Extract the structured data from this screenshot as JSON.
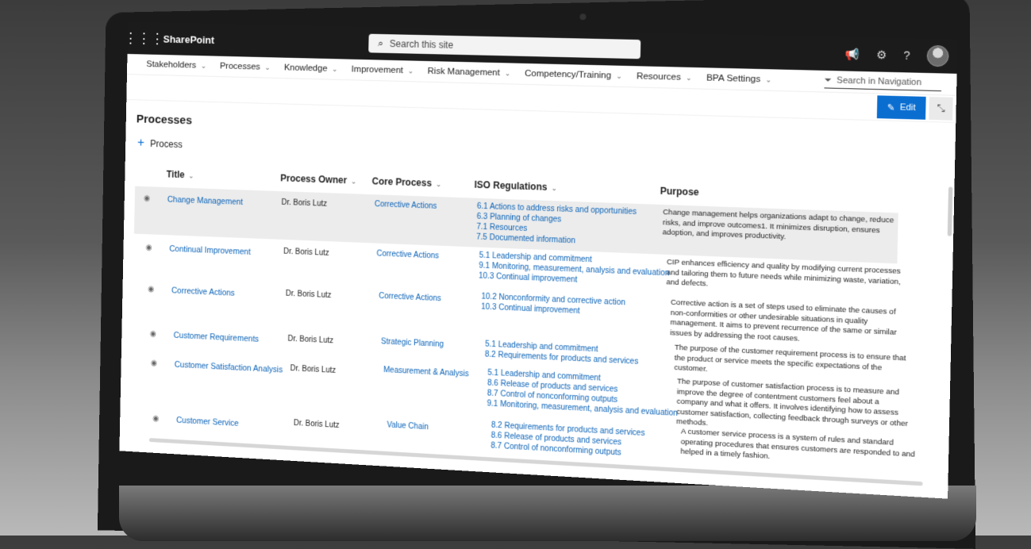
{
  "suitebar": {
    "waffle_icon": "waffle-grid-icon",
    "brand": "SharePoint",
    "search_placeholder": "Search this site",
    "icons": [
      "megaphone-icon",
      "gear-icon",
      "help-icon"
    ]
  },
  "nav": {
    "items": [
      {
        "label": "Stakeholders"
      },
      {
        "label": "Processes"
      },
      {
        "label": "Knowledge"
      },
      {
        "label": "Improvement"
      },
      {
        "label": "Risk Management"
      },
      {
        "label": "Competency/Training"
      },
      {
        "label": "Resources"
      },
      {
        "label": "BPA Settings"
      }
    ],
    "search_label": "Search in Navigation"
  },
  "commands": {
    "edit_label": "Edit"
  },
  "list": {
    "title": "Processes",
    "new_label": "Process",
    "columns": {
      "title": "Title",
      "owner": "Process Owner",
      "core": "Core Process",
      "iso": "ISO Regulations",
      "purpose": "Purpose"
    },
    "rows": [
      {
        "title": "Change Management",
        "owner": "Dr. Boris Lutz",
        "core": "Corrective Actions",
        "iso": [
          "6.1 Actions to address risks and opportunities",
          "6.3 Planning of changes",
          "7.1 Resources",
          "7.5 Documented information"
        ],
        "purpose": "Change management helps organizations adapt to change, reduce risks, and improve outcomes1. It minimizes disruption, ensures adoption, and improves productivity."
      },
      {
        "title": "Continual Improvement",
        "owner": "Dr. Boris Lutz",
        "core": "Corrective Actions",
        "iso": [
          "5.1 Leadership and commitment",
          "9.1 Monitoring, measurement, analysis and evaluation",
          "10.3 Continual improvement"
        ],
        "purpose": "CIP enhances efficiency and quality by modifying current processes and tailoring them to future needs while minimizing waste, variation, and defects."
      },
      {
        "title": "Corrective Actions",
        "owner": "Dr. Boris Lutz",
        "core": "Corrective Actions",
        "iso": [
          "10.2 Nonconformity and corrective action",
          "10.3 Continual improvement"
        ],
        "purpose": "Corrective action is a set of steps used to eliminate the causes of non-conformities or other undesirable situations in quality management. It aims to prevent recurrence of the same or similar issues by addressing the root causes."
      },
      {
        "title": "Customer Requirements",
        "owner": "Dr. Boris Lutz",
        "core": "Strategic Planning",
        "iso": [
          "5.1 Leadership and commitment",
          "8.2 Requirements for products and services"
        ],
        "purpose": "The purpose of the customer requirement process is to ensure that the product or service meets the specific expectations of the customer."
      },
      {
        "title": "Customer Satisfaction Analysis",
        "owner": "Dr. Boris Lutz",
        "core": "Measurement & Analysis",
        "iso": [
          "5.1 Leadership and commitment",
          "8.6 Release of products and services",
          "8.7 Control of nonconforming outputs",
          "9.1 Monitoring, measurement, analysis and evaluation"
        ],
        "purpose": "The purpose of customer satisfaction process is to measure and improve the degree of contentment customers feel about a company and what it offers. It involves identifying how to assess customer satisfaction, collecting feedback through surveys or other methods."
      },
      {
        "title": "Customer Service",
        "owner": "Dr. Boris Lutz",
        "core": "Value Chain",
        "iso": [
          "8.2 Requirements for products and services",
          "8.6 Release of products and services",
          "8.7 Control of nonconforming outputs"
        ],
        "purpose": "A customer service process is a system of rules and standard operating procedures that ensures customers are responded to and helped in a timely fashion."
      }
    ]
  }
}
